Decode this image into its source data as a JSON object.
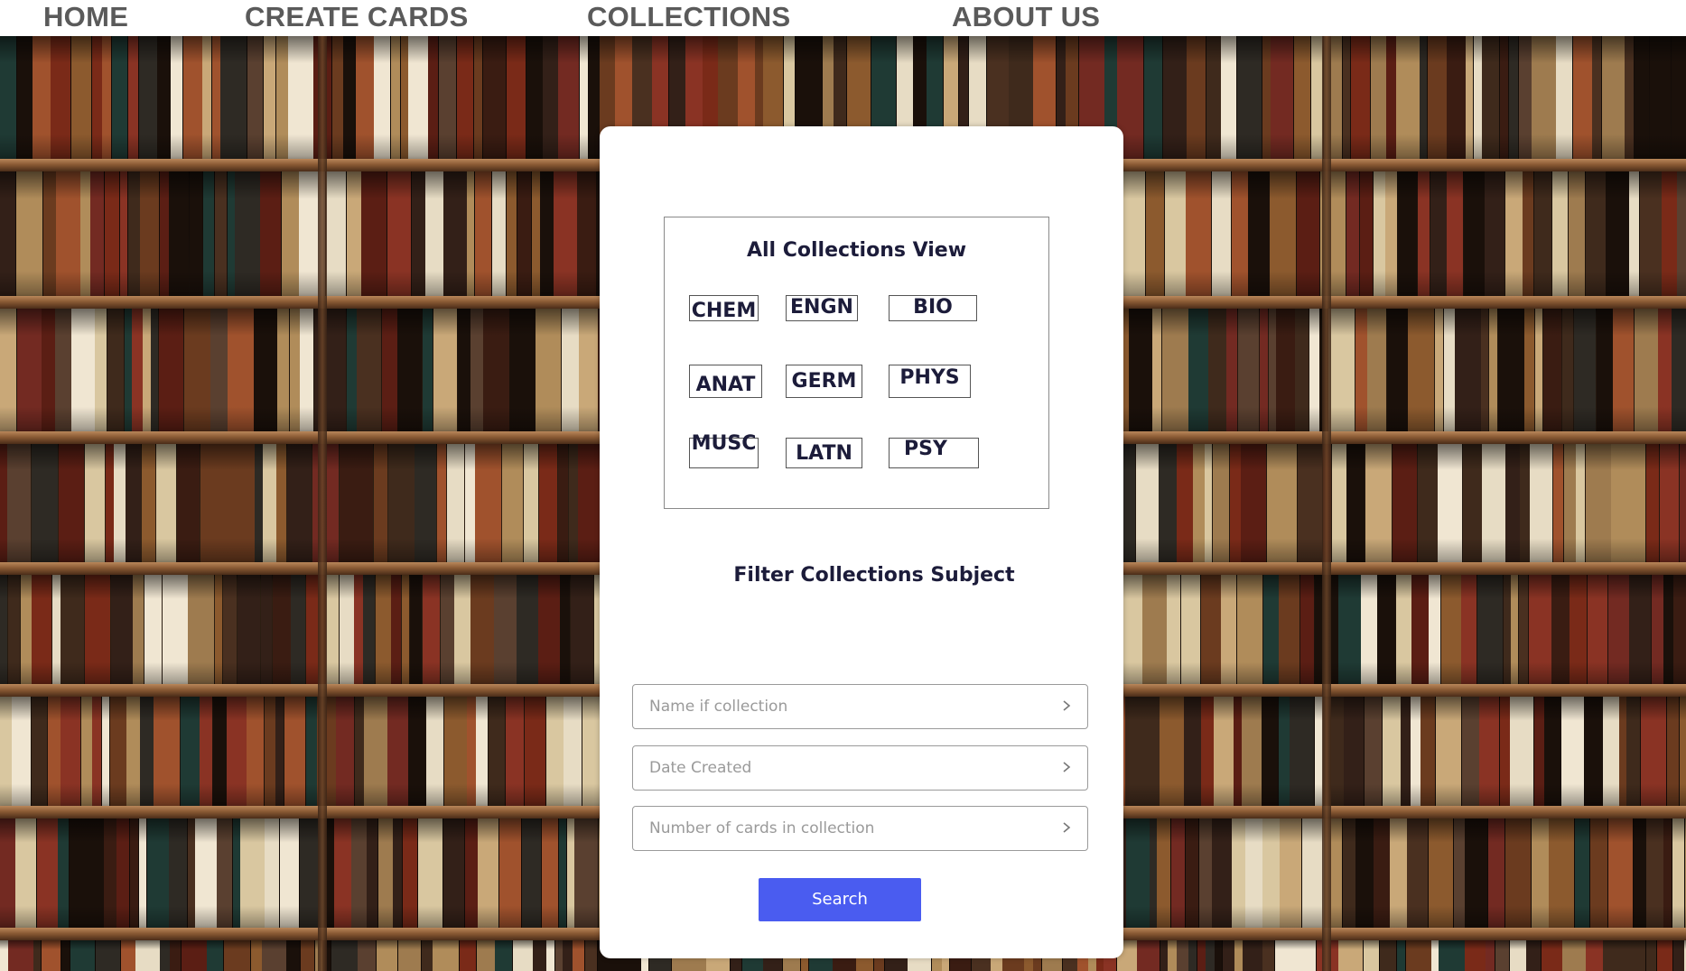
{
  "nav": {
    "items": [
      {
        "label": "HOME"
      },
      {
        "label": "CREATE CARDS"
      },
      {
        "label": "COLLECTIONS"
      },
      {
        "label": "ABOUT US"
      }
    ]
  },
  "collections_view": {
    "title": "All Collections View",
    "subjects": [
      "CHEM",
      "ENGN",
      "BIO",
      "ANAT",
      "GERM",
      "PHYS",
      "MUSC",
      "LATN",
      "PSY"
    ]
  },
  "filter": {
    "title": "Filter Collections Subject",
    "fields": [
      {
        "placeholder": "Name if collection"
      },
      {
        "placeholder": "Date Created"
      },
      {
        "placeholder": "Number of cards in collection"
      }
    ],
    "search_label": "Search"
  },
  "colors": {
    "nav_text": "#5a5a5a",
    "heading_text": "#1c1c3a",
    "button_bg": "#4a5cf0",
    "placeholder_text": "#9a9a9a"
  },
  "background": {
    "icon": "bookshelf-photo"
  }
}
